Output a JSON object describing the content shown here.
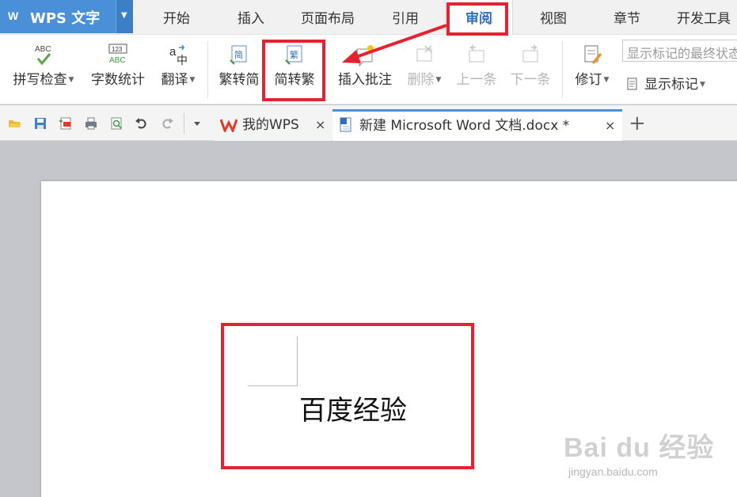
{
  "app": {
    "logo": "W",
    "title": "WPS 文字"
  },
  "menu": {
    "tabs": [
      {
        "label": "开始"
      },
      {
        "label": "插入"
      },
      {
        "label": "页面布局"
      },
      {
        "label": "引用"
      },
      {
        "label": "审阅",
        "active": true
      },
      {
        "label": "视图"
      },
      {
        "label": "章节"
      },
      {
        "label": "开发工具"
      }
    ]
  },
  "ribbon": {
    "spell_check": "拼写检查",
    "word_count": "字数统计",
    "translate": "翻译",
    "trad_to_simp": "繁转简",
    "simp_to_trad": "简转繁",
    "insert_comment": "插入批注",
    "delete": "删除",
    "previous": "上一条",
    "next": "下一条",
    "track_changes": "修订",
    "show_markup": "显示标记",
    "markup_mode": "显示标记的最终状态",
    "icon_text": {
      "abc": "ABC",
      "num": "123",
      "a": "a",
      "zh": "中",
      "jian": "简",
      "fan": "繁"
    }
  },
  "tabs": {
    "home": {
      "label": "我的WPS"
    },
    "doc": {
      "label": "新建 Microsoft Word 文档.docx *"
    },
    "close_symbol": "×",
    "new_symbol": "+"
  },
  "document": {
    "text": "百度经验"
  },
  "watermark": {
    "brand": "Bai du 经验",
    "url": "jingyan.baidu.com"
  },
  "colors": {
    "accent": "#4a90d9",
    "highlight": "#e52330",
    "active_tab_text": "#2f6fbf"
  }
}
